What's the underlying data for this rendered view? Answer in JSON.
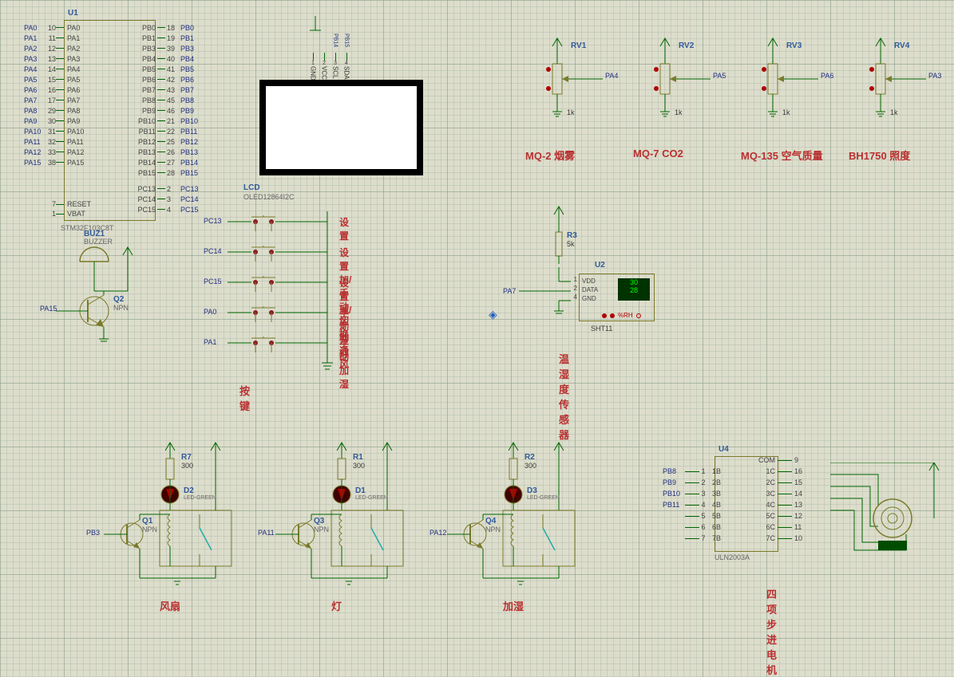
{
  "mcu": {
    "ref": "U1",
    "part": "STM32F103C8T",
    "left_pins": [
      {
        "n": "10",
        "name": "PA0"
      },
      {
        "n": "11",
        "name": "PA1"
      },
      {
        "n": "12",
        "name": "PA2"
      },
      {
        "n": "13",
        "name": "PA3"
      },
      {
        "n": "14",
        "name": "PA4"
      },
      {
        "n": "15",
        "name": "PA5"
      },
      {
        "n": "16",
        "name": "PA6"
      },
      {
        "n": "17",
        "name": "PA7"
      },
      {
        "n": "29",
        "name": "PA8"
      },
      {
        "n": "30",
        "name": "PA9"
      },
      {
        "n": "31",
        "name": "PA10"
      },
      {
        "n": "32",
        "name": "PA11"
      },
      {
        "n": "33",
        "name": "PA12"
      },
      {
        "n": "38",
        "name": "PA15"
      }
    ],
    "left_bottom": [
      {
        "n": "7",
        "name": "RESET"
      },
      {
        "n": "1",
        "name": "VBAT"
      }
    ],
    "right_pins": [
      {
        "n": "18",
        "name": "PB0"
      },
      {
        "n": "19",
        "name": "PB1"
      },
      {
        "n": "39",
        "name": "PB3"
      },
      {
        "n": "40",
        "name": "PB4"
      },
      {
        "n": "41",
        "name": "PB5"
      },
      {
        "n": "42",
        "name": "PB6"
      },
      {
        "n": "43",
        "name": "PB7"
      },
      {
        "n": "45",
        "name": "PB8"
      },
      {
        "n": "46",
        "name": "PB9"
      },
      {
        "n": "21",
        "name": "PB10"
      },
      {
        "n": "22",
        "name": "PB11"
      },
      {
        "n": "25",
        "name": "PB12"
      },
      {
        "n": "26",
        "name": "PB13"
      },
      {
        "n": "27",
        "name": "PB14"
      },
      {
        "n": "28",
        "name": "PB15"
      }
    ],
    "right_bottom_pins": [
      {
        "n": "2",
        "name": "PC13"
      },
      {
        "n": "3",
        "name": "PC14"
      },
      {
        "n": "4",
        "name": "PC15"
      }
    ]
  },
  "buzzer": {
    "ref": "BUZ1",
    "type": "BUZZER",
    "transistor_ref": "Q2",
    "transistor_type": "NPN",
    "net": "PA15"
  },
  "lcd": {
    "ref": "LCD",
    "part": "OLED12864I2C",
    "pins": [
      "GND",
      "VCC",
      "SCL",
      "SDA"
    ],
    "nets": [
      "PB14",
      "PB15"
    ],
    "idx": [
      "1",
      "2",
      "3",
      "4"
    ]
  },
  "buttons": {
    "title": "按键",
    "items": [
      {
        "net": "PC13",
        "label": "设置"
      },
      {
        "net": "PC14",
        "label": "设置加/手动切换"
      },
      {
        "net": "PC15",
        "label": "设置减/手动通风"
      },
      {
        "net": "PA0",
        "label": "手动开灯"
      },
      {
        "net": "PA1",
        "label": "手动加湿"
      }
    ]
  },
  "sht11": {
    "ref": "U2",
    "part": "SHT11",
    "r_ref": "R3",
    "r_val": "5k",
    "pins": [
      "VDD",
      "DATA",
      "GND"
    ],
    "pin_nums": [
      "1",
      "2",
      "4"
    ],
    "readout_top": "30",
    "readout_bot": "28",
    "unit": "%RH",
    "net": "PA7",
    "title": "温湿度传感器"
  },
  "pots": [
    {
      "ref": "RV1",
      "val": "1k",
      "net": "PA4",
      "title": "MQ-2 烟雾"
    },
    {
      "ref": "RV2",
      "val": "1k",
      "net": "PA5",
      "title": "MQ-7 CO2"
    },
    {
      "ref": "RV3",
      "val": "1k",
      "net": "PA6",
      "title": "MQ-135 空气质量"
    },
    {
      "ref": "RV4",
      "val": "1k",
      "net": "PA3",
      "title": "BH1750 照度"
    }
  ],
  "drivers": [
    {
      "title": "风扇",
      "q_ref": "Q1",
      "q_type": "NPN",
      "d_ref": "D2",
      "d_type": "LED-GREEN",
      "r_ref": "R7",
      "r_val": "300",
      "net": "PB3"
    },
    {
      "title": "灯",
      "q_ref": "Q3",
      "q_type": "NPN",
      "d_ref": "D1",
      "d_type": "LED-GREEN",
      "r_ref": "R1",
      "r_val": "300",
      "net": "PA11"
    },
    {
      "title": "加湿",
      "q_ref": "Q4",
      "q_type": "NPN",
      "d_ref": "D3",
      "d_type": "LED-GREEN",
      "r_ref": "R2",
      "r_val": "300",
      "net": "PA12"
    }
  ],
  "stepper": {
    "ref": "U4",
    "part": "ULN2003A",
    "title": "四项步进电机",
    "left": [
      {
        "n": "1",
        "name": "1B",
        "net": "PB8"
      },
      {
        "n": "2",
        "name": "2B",
        "net": "PB9"
      },
      {
        "n": "3",
        "name": "3B",
        "net": "PB10"
      },
      {
        "n": "4",
        "name": "4B",
        "net": "PB11"
      },
      {
        "n": "5",
        "name": "5B",
        "net": ""
      },
      {
        "n": "6",
        "name": "6B",
        "net": ""
      },
      {
        "n": "7",
        "name": "7B",
        "net": ""
      }
    ],
    "right": [
      {
        "n": "9",
        "name": "COM"
      },
      {
        "n": "16",
        "name": "1C"
      },
      {
        "n": "15",
        "name": "2C"
      },
      {
        "n": "14",
        "name": "3C"
      },
      {
        "n": "13",
        "name": "4C"
      },
      {
        "n": "12",
        "name": "5C"
      },
      {
        "n": "11",
        "name": "6C"
      },
      {
        "n": "10",
        "name": "7C"
      }
    ]
  },
  "origin_marker": "◈"
}
